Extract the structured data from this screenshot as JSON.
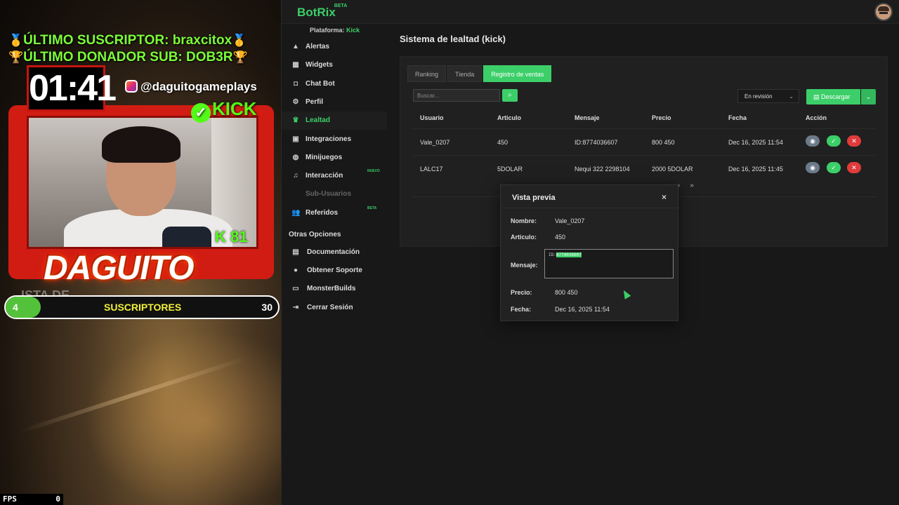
{
  "stream": {
    "last_sub": "ÚLTIMO SUSCRIPTOR: braxcitox",
    "last_donor": "ÚLTIMO DONADOR SUB: DOB3R",
    "timer": "01:41",
    "instagram": "@daguitogameplays",
    "kick": "KICK",
    "badge": "K 81",
    "name": "DAGUITO",
    "goal_bg": "ISTA DE SEADOS",
    "goal": {
      "current": "4",
      "label": "SUSCRIPTORES",
      "target": "30",
      "progress": 0.13
    },
    "fps_label": "FPS",
    "fps_value": "0"
  },
  "app": {
    "logo": "BotRix",
    "logo_badge": "BETA",
    "platform_label": "Plataforma:",
    "platform_value": "Kick",
    "nav": [
      {
        "label": "Alertas",
        "icon": "warning-icon"
      },
      {
        "label": "Widgets",
        "icon": "widgets-icon"
      },
      {
        "label": "Chat Bot",
        "icon": "robot-icon"
      },
      {
        "label": "Perfil",
        "icon": "gear-icon"
      },
      {
        "label": "Lealtad",
        "icon": "trophy-icon"
      },
      {
        "label": "Integraciones",
        "icon": "integrations-icon"
      },
      {
        "label": "Minijuegos",
        "icon": "gamepad-icon"
      },
      {
        "label": "Interacción",
        "icon": "music-icon",
        "badge": "NUEVO"
      },
      {
        "label": "Sub-Usuarios",
        "icon": ""
      },
      {
        "label": "Referidos",
        "icon": "users-icon",
        "badge": "BETA"
      }
    ],
    "section_other": "Otras Opciones",
    "nav_other": [
      {
        "label": "Documentación",
        "icon": "document-icon"
      },
      {
        "label": "Obtener Soporte",
        "icon": "help-icon"
      },
      {
        "label": "MonsterBuilds",
        "icon": "monitor-icon"
      },
      {
        "label": "Cerrar Sesión",
        "icon": "logout-icon"
      }
    ],
    "page_title": "Sistema de lealtad (kick)",
    "tabs": [
      "Ranking",
      "Tienda",
      "Registro de ventas"
    ],
    "search_placeholder": "Buscar...",
    "filter": "En revisión",
    "download": "Descargar",
    "columns": [
      "Usuario",
      "Articulo",
      "Mensaje",
      "Precio",
      "Fecha",
      "Acción"
    ],
    "rows": [
      {
        "usuario": "Vale_0207",
        "articulo": "450",
        "mensaje": "ID:8774036607",
        "precio": "800 450",
        "fecha": "Dec 16, 2025 11:54"
      },
      {
        "usuario": "LALC17",
        "articulo": "5DOLAR",
        "mensaje": "Nequi 322 2298104",
        "precio": "2000 5DOLAR",
        "fecha": "Dec 16, 2025 11:45"
      }
    ],
    "pager": [
      "›",
      "»"
    ],
    "modal": {
      "title": "Vista previa",
      "close": "×",
      "nombre_label": "Nombre:",
      "nombre": "Vale_0207",
      "articulo_label": "Articulo:",
      "articulo": "450",
      "mensaje_label": "Mensaje:",
      "mensaje_prefix": "ID:",
      "mensaje_selected": "8774036607",
      "precio_label": "Precio:",
      "precio": "800 450",
      "fecha_label": "Fecha:",
      "fecha": "Dec 16, 2025 11:54"
    }
  }
}
